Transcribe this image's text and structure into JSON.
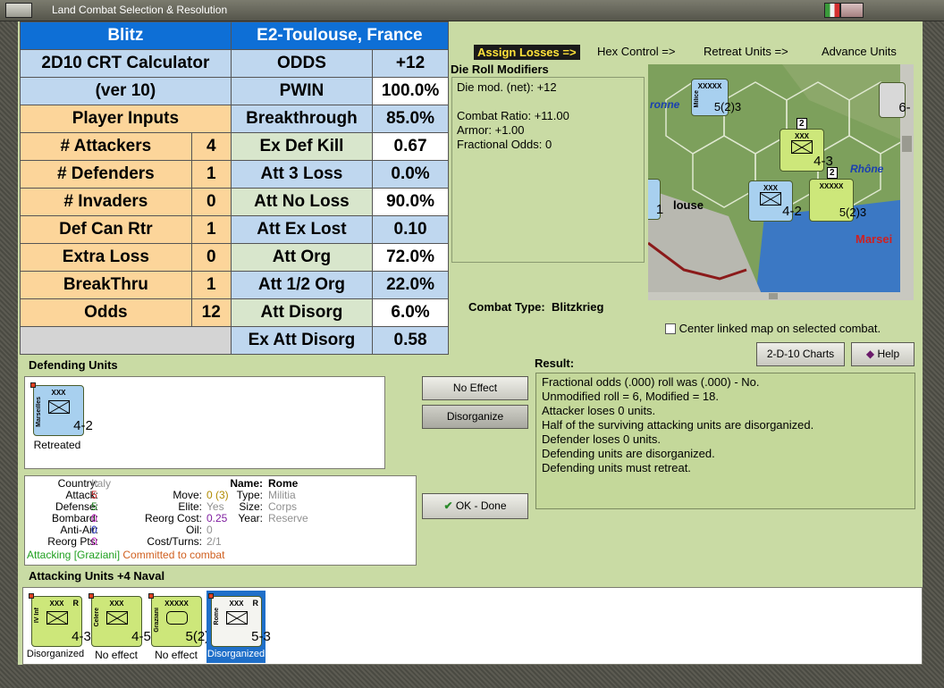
{
  "window": {
    "title": "Land Combat Selection & Resolution"
  },
  "crt": {
    "rows": [
      [
        "Blitz",
        "",
        "E2-Toulouse, France",
        ""
      ],
      [
        "2D10 CRT Calculator",
        "",
        "ODDS",
        "+12"
      ],
      [
        "(ver 10)",
        "",
        "PWIN",
        "100.0%"
      ],
      [
        "Player Inputs",
        "",
        "Breakthrough",
        "85.0%"
      ],
      [
        "# Attackers",
        "4",
        "Ex Def Kill",
        "0.67"
      ],
      [
        "# Defenders",
        "1",
        "Att 3 Loss",
        "0.0%"
      ],
      [
        "# Invaders",
        "0",
        "Att No Loss",
        "90.0%"
      ],
      [
        "Def Can Rtr",
        "1",
        "Att Ex Lost",
        "0.10"
      ],
      [
        "Extra Loss",
        "0",
        "Att Org",
        "72.0%"
      ],
      [
        "BreakThru",
        "1",
        "Att 1/2 Org",
        "22.0%"
      ],
      [
        "Odds",
        "12",
        "Att Disorg",
        "6.0%"
      ],
      [
        "",
        "",
        "Ex Att Disorg",
        "0.58"
      ]
    ]
  },
  "tabs": {
    "assign": "Assign Losses =>",
    "hex": "Hex Control =>",
    "retreat": "Retreat Units =>",
    "advance": "Advance Units"
  },
  "die": {
    "title": "Die Roll Modifiers",
    "lines": [
      "Die mod. (net): +12",
      "",
      "Combat Ratio: +11.00",
      "Armor: +1.00",
      "Fractional Odds: 0"
    ]
  },
  "combat": {
    "label": "Combat Type:",
    "value": "Blitzkrieg"
  },
  "map": {
    "labels": [
      "ronne",
      "Rhône",
      "louse",
      "Marsei"
    ],
    "units": [
      {
        "name": "Milice",
        "size": "XXXXX",
        "str": "5(2)3"
      },
      {
        "name": "IV Inf",
        "size": "XXX",
        "str": "4-3",
        "badge": "2"
      },
      {
        "name": "Marseilles",
        "size": "XXX",
        "str": "4-2"
      },
      {
        "name": "Graziani",
        "size": "XXXXX",
        "str": "5(2)3",
        "badge": "2"
      },
      {
        "name": "",
        "size": "XX",
        "str": "1"
      },
      {
        "name": "",
        "size": "",
        "str": "6-"
      }
    ]
  },
  "center_map": {
    "label": "Center linked map on selected combat."
  },
  "buttons": {
    "charts": "2-D-10 Charts",
    "help": "Help",
    "no_effect": "No Effect",
    "disorganize": "Disorganize",
    "ok": "OK - Done"
  },
  "defending": {
    "title": "Defending Units",
    "unit": {
      "name": "Marseilles",
      "size": "XXX",
      "str": "4-2",
      "status": "Retreated"
    }
  },
  "result": {
    "title": "Result:",
    "lines": [
      "Fractional odds (.000) roll was (.000)  - No.",
      "Unmodified roll = 6, Modified = 18.",
      "Attacker loses 0 units.",
      "Half of the surviving attacking units are disorganized.",
      "Defender loses 0 units.",
      "Defending units are disorganized.",
      "Defending units must retreat."
    ]
  },
  "info": {
    "left": [
      [
        "Country:",
        "Italy"
      ],
      [
        "Attack:",
        "5"
      ],
      [
        "Defense:",
        "5"
      ],
      [
        "Bombard:",
        "0"
      ],
      [
        "Anti-Air:",
        "0"
      ],
      [
        "Reorg Pts:",
        "0"
      ]
    ],
    "mid": [
      [
        "Move:",
        "0 (3)"
      ],
      [
        "Elite:",
        "Yes"
      ],
      [
        "Reorg Cost:",
        "0.25"
      ],
      [
        "Oil:",
        "0"
      ],
      [
        "Cost/Turns:",
        "2/1"
      ]
    ],
    "right": [
      [
        "Name:",
        "Rome"
      ],
      [
        "Type:",
        "Militia"
      ],
      [
        "Size:",
        "Corps"
      ],
      [
        "Year:",
        "Reserve"
      ]
    ],
    "attacking": "Attacking [Graziani]",
    "committed": "Committed to combat"
  },
  "attacking": {
    "title": "Attacking Units +4 Naval",
    "units": [
      {
        "name": "IV Inf",
        "size": "XXX",
        "str": "4-3",
        "r": "R",
        "status": "Disorganized"
      },
      {
        "name": "Celere",
        "size": "XXX",
        "str": "4-5",
        "r": "",
        "status": "No effect"
      },
      {
        "name": "Graziani",
        "size": "XXXXX",
        "str": "5(2)3",
        "r": "",
        "status": "No effect"
      },
      {
        "name": "Rome",
        "size": "XXX",
        "str": "5-3",
        "r": "R",
        "status": "Disorganized"
      }
    ]
  },
  "colors": {
    "unit_green": "#cde77a",
    "unit_blue": "#a8d0ef",
    "selected": "#1f6fc9",
    "panel_green": "#c9dba4"
  }
}
